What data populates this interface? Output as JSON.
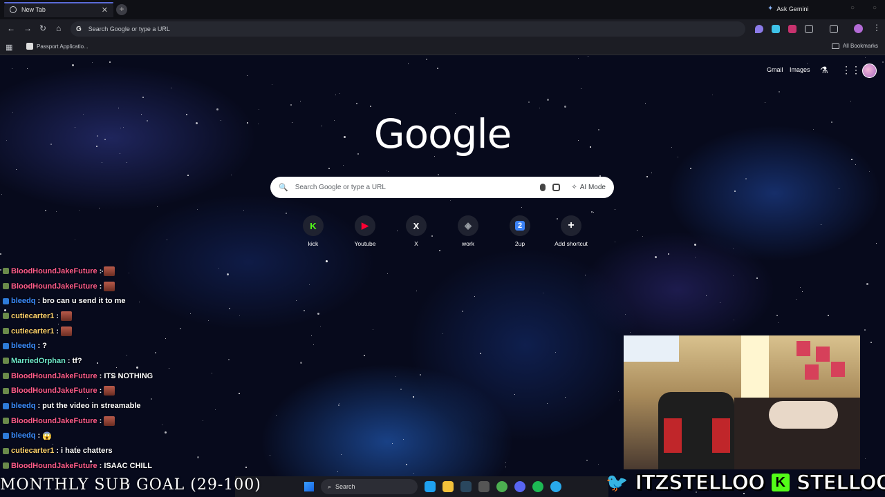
{
  "browser": {
    "tab_title": "New Tab",
    "tab_close": "✕",
    "new_tab": "+",
    "ask_gemini": "Ask Gemini",
    "omnibox_placeholder": "Search Google or type a URL",
    "bookmark_item": "Passport Applicatio...",
    "all_bookmarks": "All Bookmarks"
  },
  "google": {
    "gmail": "Gmail",
    "images": "Images",
    "logo": "Google",
    "search_placeholder": "Search Google or type a URL",
    "ai_mode": "AI Mode",
    "shortcuts": [
      {
        "label": "kick",
        "glyph": "K",
        "color": "#53fc18"
      },
      {
        "label": "Youtube",
        "glyph": "▶",
        "color": "#ff0033"
      },
      {
        "label": "X",
        "glyph": "X",
        "color": "#ffffff"
      },
      {
        "label": "work",
        "glyph": "◈",
        "color": "#9aa0a6"
      },
      {
        "label": "2up",
        "glyph": "2",
        "color": "#3b82f6"
      },
      {
        "label": "Add shortcut",
        "glyph": "+",
        "color": "#ffffff"
      }
    ]
  },
  "chat": [
    {
      "user": "BloodHoundJakeFuture",
      "user_color": "#ff5c8a",
      "message": "",
      "emote": true
    },
    {
      "user": "BloodHoundJakeFuture",
      "user_color": "#ff5c8a",
      "message": "",
      "emote": true
    },
    {
      "user": "bleedq",
      "user_color": "#3b8dff",
      "message": "bro can u send it to me",
      "emote": false
    },
    {
      "user": "cutiecarter1",
      "user_color": "#ffd36b",
      "message": "",
      "emote": true
    },
    {
      "user": "cutiecarter1",
      "user_color": "#ffd36b",
      "message": "",
      "emote": true
    },
    {
      "user": "bleedq",
      "user_color": "#3b8dff",
      "message": "?",
      "emote": false
    },
    {
      "user": "MarriedOrphan",
      "user_color": "#6ee7c8",
      "message": "tf?",
      "emote": false
    },
    {
      "user": "BloodHoundJakeFuture",
      "user_color": "#ff5c8a",
      "message": "ITS NOTHING",
      "emote": false
    },
    {
      "user": "BloodHoundJakeFuture",
      "user_color": "#ff5c8a",
      "message": "",
      "emote": true
    },
    {
      "user": "bleedq",
      "user_color": "#3b8dff",
      "message": "put the video in streamable",
      "emote": false
    },
    {
      "user": "BloodHoundJakeFuture",
      "user_color": "#ff5c8a",
      "message": "",
      "emote": true
    },
    {
      "user": "bleedq",
      "user_color": "#3b8dff",
      "message": "😱",
      "emote": false
    },
    {
      "user": "cutiecarter1",
      "user_color": "#ffd36b",
      "message": "i hate chatters",
      "emote": false
    },
    {
      "user": "BloodHoundJakeFuture",
      "user_color": "#ff5c8a",
      "message": "ISAAC CHILL",
      "emote": false
    }
  ],
  "overlay": {
    "sub_goal": "MONTHLY SUB GOAL (29-100)",
    "twitter_handle": "ITZSTELLOO",
    "kick_handle": "STELLOOO"
  },
  "taskbar": {
    "search": "Search"
  }
}
